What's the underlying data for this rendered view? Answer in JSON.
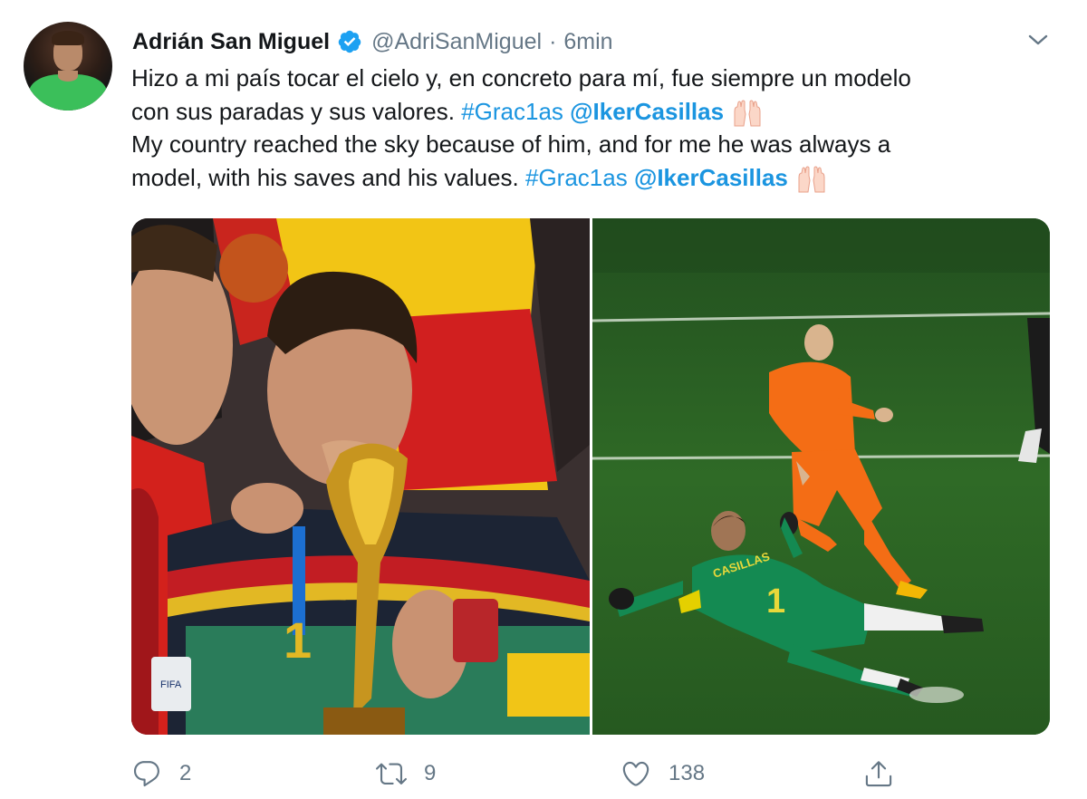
{
  "tweet": {
    "author": {
      "display_name": "Adrián San Miguel",
      "handle": "@AdriSanMiguel",
      "separator": "·",
      "time": "6min",
      "verified_icon": "verified-badge-icon"
    },
    "text": {
      "line1": "Hizo a mi país tocar el cielo y, en concreto para mí, fue siempre un modelo",
      "line2_text": "con sus paradas y sus valores. ",
      "line2_hashtag": "#Grac1as",
      "line2_mention": "@IkerCasillas",
      "line3": "My country reached the sky because of him, and for me he was always a",
      "line4_text": "model, with his saves and his values. ",
      "line4_hashtag": "#Grac1as",
      "line4_mention": "@IkerCasillas",
      "emoji": "raising-hands-emoji"
    },
    "media": {
      "left_jersey_text": "FIFA",
      "right_jersey_name": "CASILLAS",
      "right_jersey_number": "1",
      "left_jersey_number": "1"
    },
    "actions": {
      "reply_count": "2",
      "retweet_count": "9",
      "like_count": "138",
      "share_count": ""
    }
  },
  "colors": {
    "link": "#1b95e0",
    "secondary_text": "#657786",
    "verified": "#1da1f2",
    "primary_text": "#14171a"
  }
}
